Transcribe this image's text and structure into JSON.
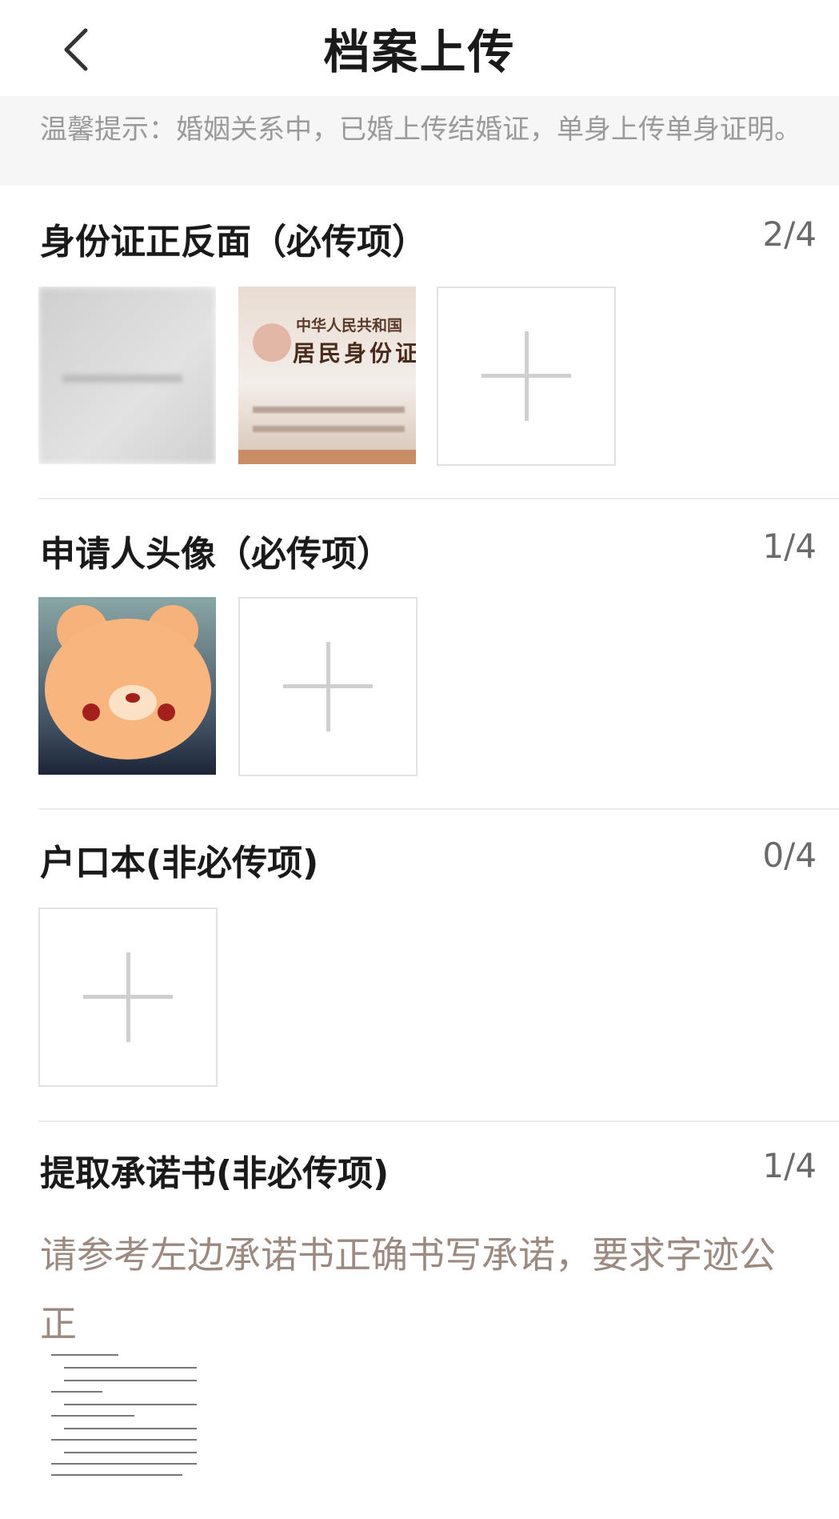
{
  "header": {
    "title": "档案上传",
    "back_icon": "chevron-left-icon"
  },
  "notice": {
    "text": "温馨提示：婚姻关系中，已婚上传结婚证，单身上传单身证明。"
  },
  "sections": [
    {
      "title": "身份证正反面（必传项）",
      "count": "2/4"
    },
    {
      "title": "申请人头像（必传项）",
      "count": "1/4"
    },
    {
      "title": "户口本(非必传项)",
      "count": "0/4"
    },
    {
      "title": "提取承诺书(非必传项)",
      "count": "1/4"
    }
  ],
  "id_card": {
    "line1": "中华人民共和国",
    "line2": "居民身份证"
  },
  "commitment_hint": "请参考左边承诺书正确书写承诺，要求字迹公正",
  "colors": {
    "hint": "#9c8a80",
    "count": "#6a6a6a",
    "notice_bg": "#f6f6f6"
  }
}
